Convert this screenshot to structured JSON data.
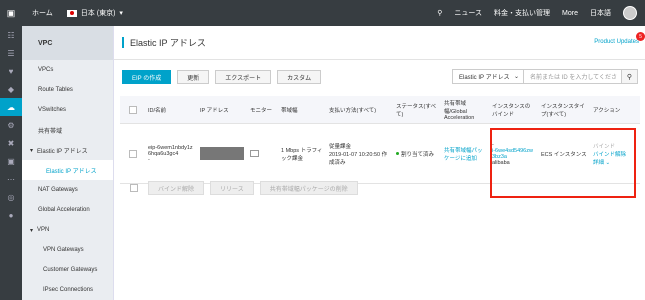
{
  "topbar": {
    "logo_icon": "cloud-logo-icon",
    "home_label": "ホーム",
    "region_label": "日本 (東京)",
    "news_label": "ニュース",
    "billing_label": "料金・支払い管理",
    "more_label": "More",
    "lang_label": "日本語"
  },
  "iconbar": [
    "grid-icon",
    "list-icon",
    "heart-icon",
    "shield-icon",
    "cloud-icon",
    "gear-icon",
    "cross-icon",
    "lock-icon",
    "dots-icon",
    "globe-icon",
    "circle-icon"
  ],
  "sidebar": {
    "title": "VPC",
    "items": [
      {
        "label": "VPCs"
      },
      {
        "label": "Route Tables"
      },
      {
        "label": "VSwitches"
      },
      {
        "label": "共有帯域"
      },
      {
        "label": "Elastic IP アドレス"
      },
      {
        "label": "Elastic IP アドレス"
      },
      {
        "label": "NAT Gateways"
      },
      {
        "label": "Global Acceleration"
      },
      {
        "label": "VPN"
      },
      {
        "label": "VPN Gateways"
      },
      {
        "label": "Customer Gateways"
      },
      {
        "label": "IPsec Connections"
      }
    ]
  },
  "page": {
    "title": "Elastic IP アドレス",
    "updates_label": "Product Updates",
    "updates_count": "5"
  },
  "toolbar": {
    "create_label": "EIP の作成",
    "refresh_label": "更新",
    "export_label": "エクスポート",
    "custom_label": "カスタム"
  },
  "search": {
    "select_value": "Elastic IP アドレス",
    "placeholder": "名前または ID を入力してくださ"
  },
  "table": {
    "headers": [
      "ID/名前",
      "IP アドレス",
      "モニター",
      "帯域幅",
      "支払い方法(すべて)",
      "ステータス(すべて)",
      "共有帯域幅/Global Acceleration",
      "インスタンスのバインド",
      "インスタンスタイプ(すべて)",
      "アクション"
    ],
    "row": {
      "id": "eip-6wem1nbdy1z6hqa6u3gc4",
      "name": "-",
      "bandwidth": "1 Mbps トラフィック課金",
      "billing": "従量課金",
      "billing_time": "2019-01-07 10:20:50 作成済み",
      "status": "割り当て済み",
      "shared": "共有帯域幅パッケージに追加",
      "instance_dash": "-",
      "instance_id": "i-6we4sd5496zw3bz3a",
      "instance_name": "alibaba",
      "instance_type": "ECS インスタンス",
      "action_bind": "バインド",
      "action_unbind": "バインド解除",
      "action_detail": "詳細"
    }
  },
  "bottom": {
    "unbind_label": "バインド解除",
    "release_label": "リリース",
    "delete_shared_label": "共有帯域幅パッケージの削除"
  },
  "highlight_color": "#e21111",
  "accent_color": "#00a2ca"
}
